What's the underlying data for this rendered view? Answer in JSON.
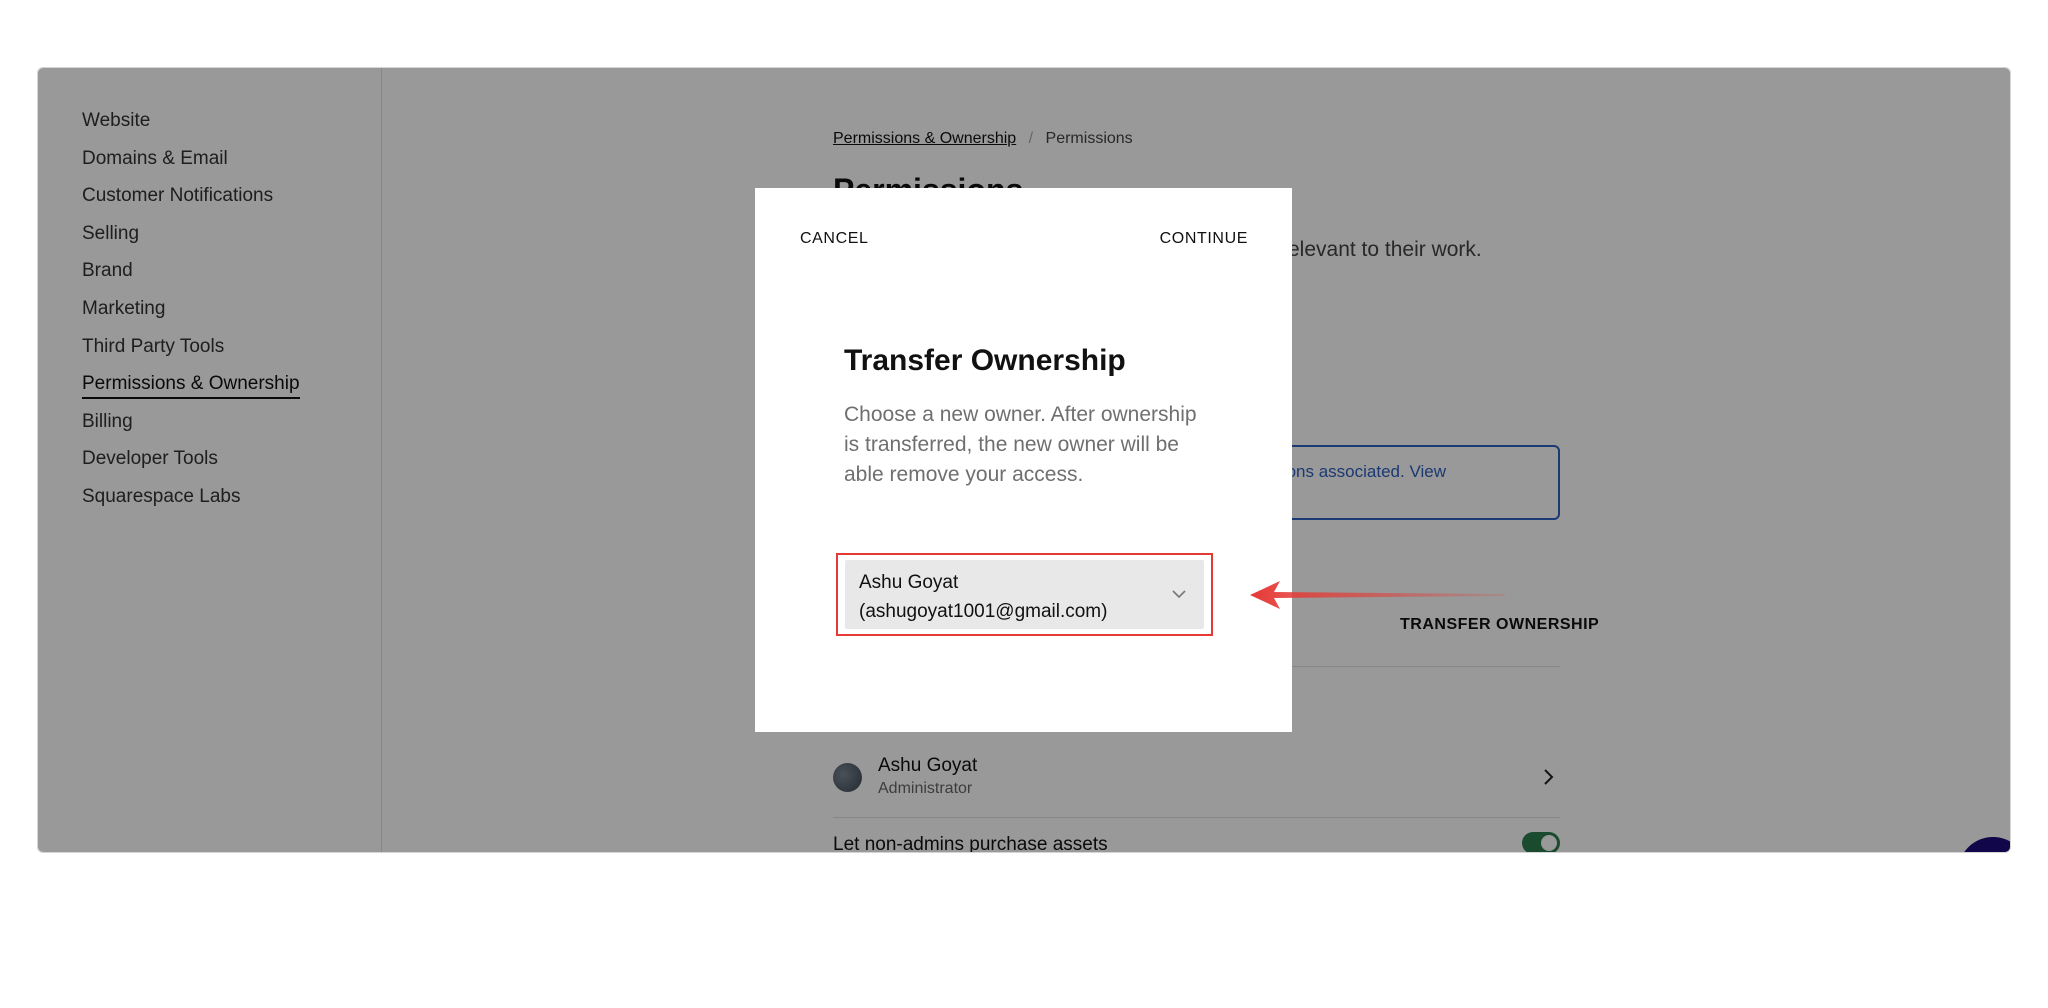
{
  "sidebar": {
    "items": [
      {
        "label": "Website"
      },
      {
        "label": "Domains & Email"
      },
      {
        "label": "Customer Notifications"
      },
      {
        "label": "Selling"
      },
      {
        "label": "Brand"
      },
      {
        "label": "Marketing"
      },
      {
        "label": "Third Party Tools"
      },
      {
        "label": "Permissions & Ownership",
        "active": true
      },
      {
        "label": "Billing"
      },
      {
        "label": "Developer Tools"
      },
      {
        "label": "Squarespace Labs"
      }
    ]
  },
  "main": {
    "breadcrumb": {
      "parent": "Permissions & Ownership",
      "separator": "/",
      "current": "Permissions"
    },
    "title": "Permissions",
    "description_visible": "elevant to their work.",
    "notice_visible": "ons associated. View",
    "transfer_label": "TRANSFER OWNERSHIP",
    "member": {
      "name": "Ashu Goyat",
      "role": "Administrator"
    },
    "toggle_label": "Let non-admins purchase assets"
  },
  "modal": {
    "cancel_label": "CANCEL",
    "continue_label": "CONTINUE",
    "title": "Transfer Ownership",
    "description": "Choose a new owner. After ownership is transferred, the new owner will be able remove your access.",
    "select": {
      "name": "Ashu Goyat",
      "email": "(ashugoyat1001@gmail.com)"
    }
  },
  "colors": {
    "highlight_border": "#e53935",
    "annotation_arrow": "#e53935",
    "notice_blue": "#2d5fbf",
    "toggle_on": "#2e7d4f"
  },
  "icons": [
    "chevron-down-icon",
    "chevron-right-icon",
    "annotation-arrow-icon"
  ]
}
